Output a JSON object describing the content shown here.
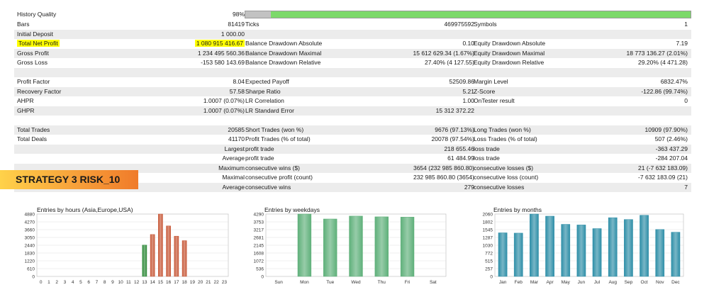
{
  "history": {
    "label": "History Quality",
    "value": "98%",
    "bar_color": "#7cd96a",
    "bar_missing_color": "#c2c2c2"
  },
  "stats_rows": [
    {
      "id": "bars",
      "c1_label": "Bars",
      "c1_value": "81419",
      "c2_label": "Ticks",
      "c2_value": "469975592",
      "c3_label": "Symbols",
      "c3_value": "1",
      "shade": false
    },
    {
      "id": "deposit",
      "c1_label": "Initial Deposit",
      "c1_value": "1 000.00",
      "c2_label": "",
      "c2_value": "",
      "c3_label": "",
      "c3_value": "",
      "shade": true
    },
    {
      "id": "netprofit",
      "c1_label": "Total Net Profit",
      "c1_value": "1 080 915 416.67",
      "c2_label": "Balance Drawdown Absolute",
      "c2_value": "0.10",
      "c3_label": "Equity Drawdown Absolute",
      "c3_value": "7.19",
      "shade": false,
      "highlight": true
    },
    {
      "id": "grossprofit",
      "c1_label": "Gross Profit",
      "c1_value": "1 234 495 560.36",
      "c2_label": "Balance Drawdown Maximal",
      "c2_value": "15 612 629.34 (1.67%)",
      "c3_label": "Equity Drawdown Maximal",
      "c3_value": "18 773 136.27 (2.01%)",
      "shade": true
    },
    {
      "id": "grossloss",
      "c1_label": "Gross Loss",
      "c1_value": "-153 580 143.69",
      "c2_label": "Balance Drawdown Relative",
      "c2_value": "27.40% (4 127.55)",
      "c3_label": "Equity Drawdown Relative",
      "c3_value": "29.20% (4 471.28)",
      "shade": false
    },
    {
      "id": "gap1",
      "c1_label": "",
      "c1_value": "",
      "c2_label": "",
      "c2_value": "",
      "c3_label": "",
      "c3_value": "",
      "shade": true
    },
    {
      "id": "pf",
      "c1_label": "Profit Factor",
      "c1_value": "8.04",
      "c2_label": "Expected Payoff",
      "c2_value": "52509.86",
      "c3_label": "Margin Level",
      "c3_value": "6832.47%",
      "shade": false
    },
    {
      "id": "rf",
      "c1_label": "Recovery Factor",
      "c1_value": "57.58",
      "c2_label": "Sharpe Ratio",
      "c2_value": "5.21",
      "c3_label": "Z-Score",
      "c3_value": "-122.86 (99.74%)",
      "shade": true
    },
    {
      "id": "ahpr",
      "c1_label": "AHPR",
      "c1_value": "1.0007 (0.07%)",
      "c2_label": "LR Correlation",
      "c2_value": "1.00",
      "c3_label": "OnTester result",
      "c3_value": "0",
      "shade": false
    },
    {
      "id": "ghpr",
      "c1_label": "GHPR",
      "c1_value": "1.0007 (0.07%)",
      "c2_label": "LR Standard Error",
      "c2_value": "15 312 372.22",
      "c3_label": "",
      "c3_value": "",
      "shade": true
    },
    {
      "id": "gap2",
      "c1_label": "",
      "c1_value": "",
      "c2_label": "",
      "c2_value": "",
      "c3_label": "",
      "c3_value": "",
      "shade": false
    },
    {
      "id": "trades",
      "c1_label": "Total Trades",
      "c1_value": "20585",
      "c2_label": "Short Trades (won %)",
      "c2_value": "9676 (97.13%)",
      "c3_label": "Long Trades (won %)",
      "c3_value": "10909 (97.90%)",
      "shade": true
    },
    {
      "id": "deals",
      "c1_label": "Total Deals",
      "c1_value": "41170",
      "c2_label": "Profit Trades (% of total)",
      "c2_value": "20078 (97.54%)",
      "c3_label": "Loss Trades (% of total)",
      "c3_value": "507 (2.46%)",
      "shade": false
    },
    {
      "id": "largest",
      "c1_label": "",
      "c1_value": "Largest",
      "c2_label": "profit trade",
      "c2_value": "218 655.46",
      "c3_label": "loss trade",
      "c3_value": "-363 437.29",
      "shade": true
    },
    {
      "id": "average",
      "c1_label": "",
      "c1_value": "Average",
      "c2_label": "profit trade",
      "c2_value": "61 484.99",
      "c3_label": "loss trade",
      "c3_value": "-284 207.04",
      "shade": false
    },
    {
      "id": "maximum",
      "c1_label": "",
      "c1_value": "Maximum",
      "c2_label": "consecutive wins ($)",
      "c2_value": "3654 (232 985 860.80)",
      "c3_label": "consecutive losses ($)",
      "c3_value": "21 (-7 632 183.09)",
      "shade": true
    },
    {
      "id": "maximal",
      "c1_label": "",
      "c1_value": "Maximal",
      "c2_label": "consecutive profit (count)",
      "c2_value": "232 985 860.80 (3654)",
      "c3_label": "consecutive loss (count)",
      "c3_value": "-7 632 183.09 (21)",
      "shade": false
    },
    {
      "id": "average2",
      "c1_label": "",
      "c1_value": "Average",
      "c2_label": "consecutive wins",
      "c2_value": "279",
      "c3_label": "consecutive losses",
      "c3_value": "7",
      "shade": true
    }
  ],
  "banner": {
    "text": "STRATEGY 3 RISK_10"
  },
  "chart_data": [
    {
      "type": "bar",
      "title": "Entries by hours (Asia,Europe,USA)",
      "categories": [
        "0",
        "1",
        "2",
        "3",
        "4",
        "5",
        "6",
        "7",
        "8",
        "9",
        "10",
        "11",
        "12",
        "13",
        "14",
        "15",
        "16",
        "17",
        "18",
        "19",
        "20",
        "21",
        "22",
        "23"
      ],
      "values": [
        0,
        0,
        0,
        0,
        0,
        0,
        0,
        0,
        0,
        0,
        0,
        0,
        0,
        2450,
        3280,
        4880,
        3950,
        3150,
        2800,
        0,
        0,
        0,
        0,
        0
      ],
      "bar_colors": {
        "13": "#2f8a3a",
        "14": "#c85a3a",
        "15": "#c85a3a",
        "16": "#c85a3a",
        "17": "#c85a3a",
        "18": "#c85a3a"
      },
      "yticks": [
        "0",
        "610",
        "1220",
        "1830",
        "2440",
        "3050",
        "3660",
        "4270",
        "4880"
      ],
      "ylim": [
        0,
        4880
      ],
      "grid": true
    },
    {
      "type": "bar",
      "title": "Entries by weekdays",
      "categories": [
        "Sun",
        "Mon",
        "Tue",
        "Wed",
        "Thu",
        "Fri",
        "Sat"
      ],
      "values": [
        0,
        4290,
        3950,
        4150,
        4100,
        4080,
        0
      ],
      "bar_color": "#5fb07a",
      "yticks": [
        "0",
        "536",
        "1072",
        "1608",
        "2145",
        "2681",
        "3217",
        "3753",
        "4290"
      ],
      "ylim": [
        0,
        4290
      ],
      "grid": true
    },
    {
      "type": "bar",
      "title": "Entries by months",
      "categories": [
        "Jan",
        "Feb",
        "Mar",
        "Apr",
        "May",
        "Jun",
        "Jul",
        "Aug",
        "Sep",
        "Oct",
        "Nov",
        "Dec"
      ],
      "values": [
        1440,
        1430,
        2060,
        1990,
        1720,
        1700,
        1580,
        1940,
        1880,
        2020,
        1550,
        1460
      ],
      "bar_color": "#2f8fa8",
      "yticks": [
        "0",
        "257",
        "515",
        "772",
        "1030",
        "1287",
        "1545",
        "1802",
        "2060"
      ],
      "ylim": [
        0,
        2060
      ],
      "grid": true
    }
  ]
}
